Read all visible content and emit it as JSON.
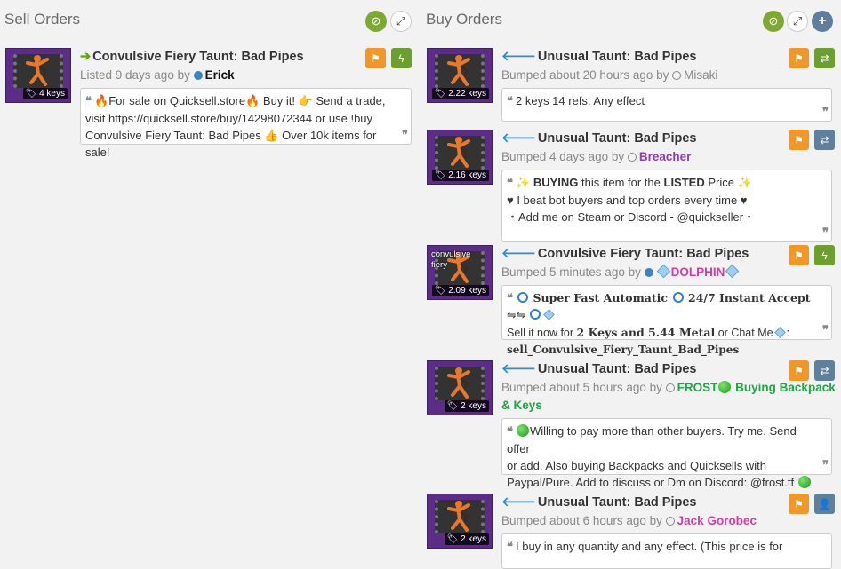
{
  "sell": {
    "title": "Sell Orders",
    "listings": [
      {
        "title": "Convulsive Fiery Taunt: Bad Pipes",
        "price": "4 keys",
        "meta_prefix": "Listed 9 days ago by",
        "user": "Erick",
        "msg_1": "For sale on Quicksell.store",
        "msg_2": "Buy it!",
        "msg_3": "Send a trade,",
        "msg_4": "visit https://quicksell.store/buy/14298072344 or use !buy",
        "msg_5": "Convulsive Fiery Taunt: Bad Pipes",
        "msg_6": "Over 10k items for sale!"
      }
    ]
  },
  "buy": {
    "title": "Buy Orders",
    "listings": [
      {
        "title": "Unusual Taunt: Bad Pipes",
        "price": "2.22 keys",
        "meta_prefix": "Bumped about 20 hours ago by",
        "user": "Misaki",
        "msg": "2 keys 14 refs. Any effect"
      },
      {
        "title": "Unusual Taunt: Bad Pipes",
        "price": "2.16 keys",
        "meta_prefix": "Bumped 4 days ago by",
        "user": "Breacher",
        "msg_buying": "BUYING",
        "msg_mid": "this item for the",
        "msg_listed": "LISTED",
        "msg_price": "Price",
        "msg_line2": "♥ I beat bot buyers and top orders every time ♥",
        "msg_line3": "・Add me on Steam or Discord - @quickseller・"
      },
      {
        "title": "Convulsive Fiery Taunt: Bad Pipes",
        "price": "2.09 keys",
        "overlay": "convulsive fiery",
        "meta_prefix": "Bumped 5 minutes ago by",
        "user": "DOLPHIN",
        "msg_fast": "Super Fast Automatic",
        "msg_instant": "24/7 Instant Accept",
        "msg_arrows": "⇋⇋",
        "msg_sell": "Sell it now for",
        "msg_amount": "2 Keys and 5.44 Metal",
        "msg_chat": "or Chat Me",
        "msg_cmd": "sell_Convulsive_Fiery_Taunt_Bad_Pipes"
      },
      {
        "title": "Unusual Taunt: Bad Pipes",
        "price": "2 keys",
        "meta_prefix": "Bumped about 5 hours ago by",
        "user_a": "FROST",
        "user_b": "Buying Backpack",
        "user_c": "& Keys",
        "msg_1": "Willing to pay more than other buyers. Try me. Send offer",
        "msg_2": "or add. Also buying Backpacks and Quicksells with",
        "msg_3": "Paypal/Pure. Add to discuss or Dm on Discord: @frost.tf"
      },
      {
        "title": "Unusual Taunt: Bad Pipes",
        "price": "2 keys",
        "meta_prefix": "Bumped about 6 hours ago by",
        "user": "Jack Gorobec",
        "msg": "I buy in any quantity and any effect. (This price is for"
      }
    ]
  }
}
